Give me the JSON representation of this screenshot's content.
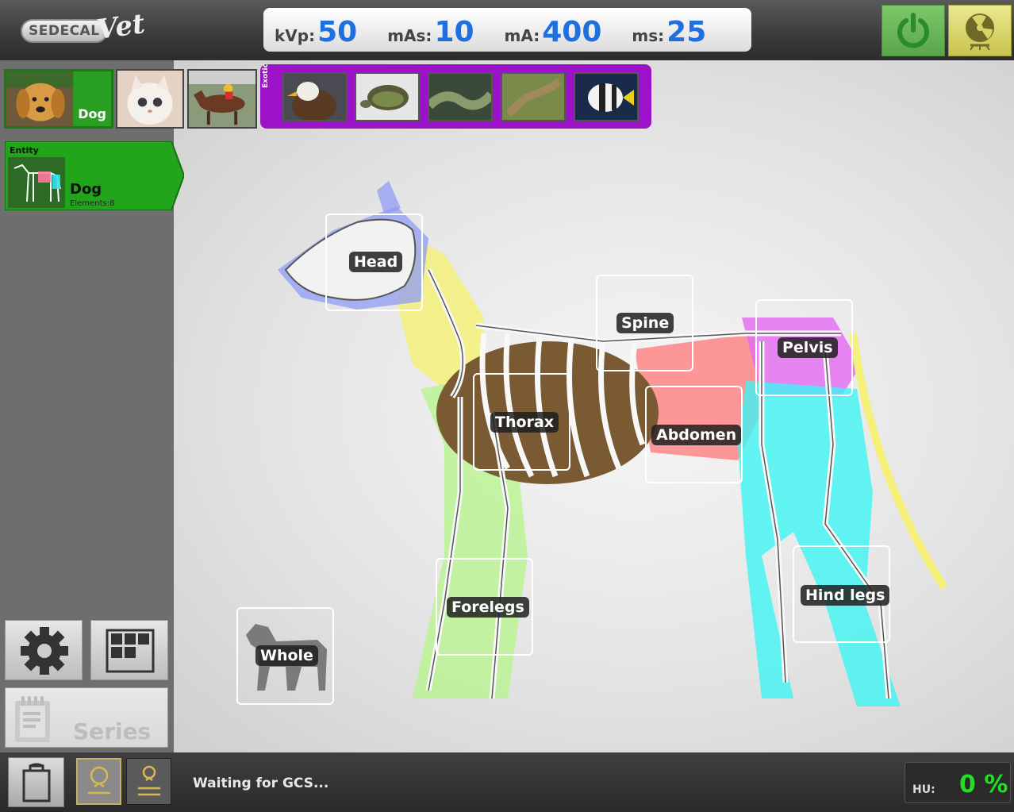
{
  "header": {
    "logo_text": "SEDECAL",
    "logo_script": "Vet",
    "params": [
      {
        "label": "kVp:",
        "value": "50"
      },
      {
        "label": "mAs:",
        "value": "10"
      },
      {
        "label": "mA:",
        "value": "400"
      },
      {
        "label": "ms:",
        "value": "25"
      }
    ],
    "power_icon": "power-icon",
    "xray_icon": "radiation-icon"
  },
  "animals": {
    "tabs": [
      {
        "name": "dog",
        "label": "Dog",
        "active": true
      },
      {
        "name": "cat",
        "label": "",
        "active": false
      },
      {
        "name": "horse",
        "label": "",
        "active": false
      }
    ],
    "exotic_label": "Exotic",
    "exotic_items": [
      "eagle",
      "turtle",
      "snake",
      "lizard",
      "fish"
    ]
  },
  "entity": {
    "title": "Entity",
    "name": "Dog",
    "elements": "Elements:8"
  },
  "regions": [
    {
      "id": "head",
      "label": "Head"
    },
    {
      "id": "spine",
      "label": "Spine"
    },
    {
      "id": "pelvis",
      "label": "Pelvis"
    },
    {
      "id": "thorax",
      "label": "Thorax"
    },
    {
      "id": "abdomen",
      "label": "Abdomen"
    },
    {
      "id": "forelegs",
      "label": "Forelegs"
    },
    {
      "id": "hind-legs",
      "label": "Hind legs"
    },
    {
      "id": "whole",
      "label": "Whole"
    }
  ],
  "left_buttons": {
    "settings_icon": "gear-icon",
    "grid_icon": "grid-icon",
    "series_label": "Series"
  },
  "footer": {
    "status": "Waiting for GCS...",
    "hu_label": "HU:",
    "hu_value": "0 %"
  }
}
